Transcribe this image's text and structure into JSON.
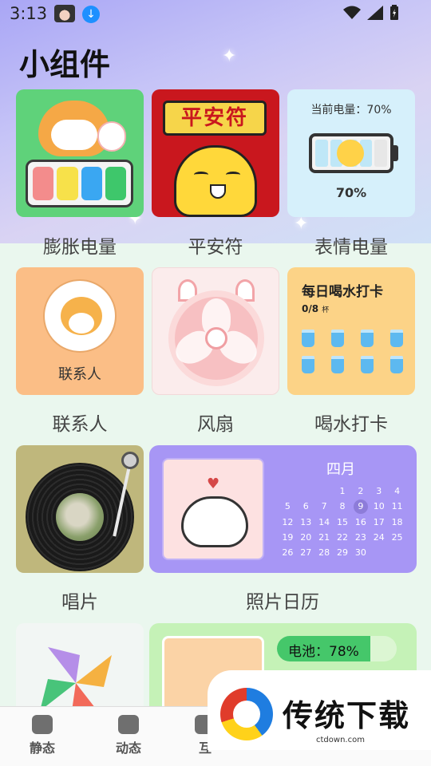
{
  "status_bar": {
    "time": "3:13"
  },
  "page": {
    "title": "小组件"
  },
  "widgets": {
    "inflate_battery": {
      "label": "膨胀电量"
    },
    "ping_an_fu": {
      "label": "平安符",
      "banner": "平安符"
    },
    "emoji_battery": {
      "label": "表情电量",
      "current_text": "当前电量：70%",
      "percent_text": "70%",
      "level": 0.7
    },
    "contacts": {
      "label": "联系人",
      "inner_label": "联系人"
    },
    "fan": {
      "label": "风扇"
    },
    "water": {
      "label": "喝水打卡",
      "title": "每日喝水打卡",
      "count": "0/8",
      "unit": "杯",
      "cups": 8
    },
    "record": {
      "label": "唱片"
    },
    "photo_calendar": {
      "label": "照片日历",
      "month": "四月",
      "days": [
        "",
        "",
        "",
        "1",
        "2",
        "3",
        "4",
        "5",
        "6",
        "7",
        "8",
        "9",
        "10",
        "11",
        "12",
        "13",
        "14",
        "15",
        "16",
        "17",
        "18",
        "19",
        "20",
        "21",
        "22",
        "23",
        "24",
        "25",
        "26",
        "27",
        "28",
        "29",
        "30"
      ],
      "today": "9"
    },
    "battery_bar": {
      "text": "电池：78%",
      "level": 0.78
    }
  },
  "bottom_nav": {
    "items": [
      {
        "label": "静态"
      },
      {
        "label": "动态"
      },
      {
        "label": "互"
      }
    ]
  },
  "watermark": {
    "brand": "传统下载",
    "url": "ctdown.com"
  },
  "colors": {
    "accent_purple": "#a796f5",
    "battery_green": "#45c76a"
  }
}
